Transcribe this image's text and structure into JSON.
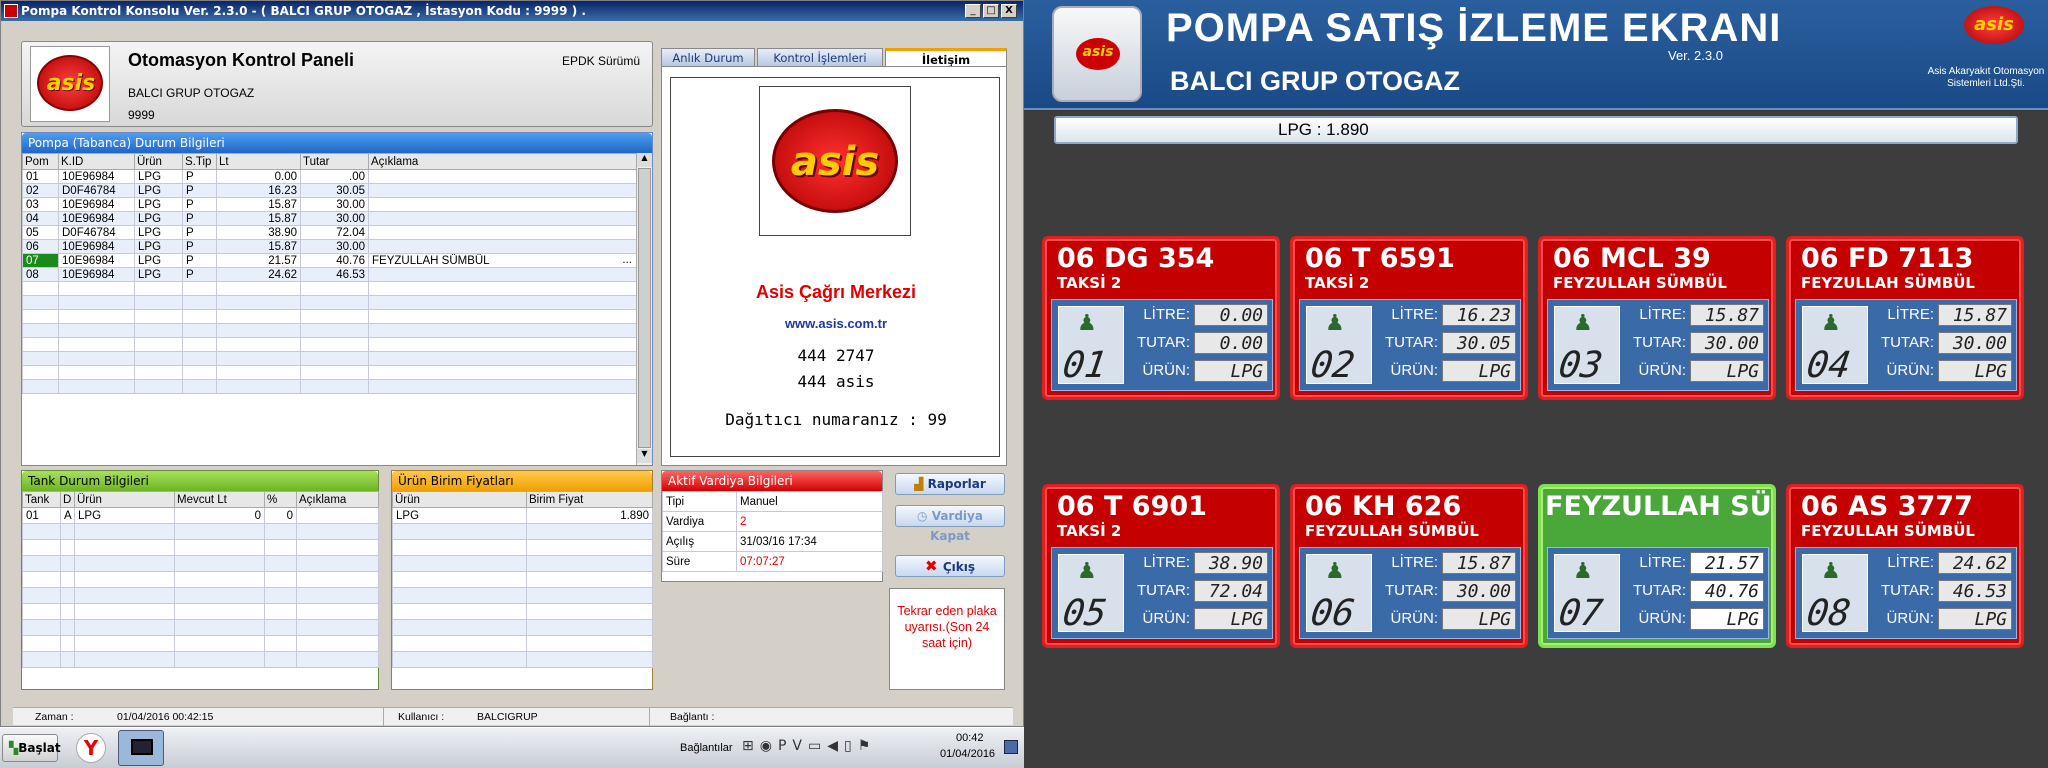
{
  "window": {
    "title": "Pompa Kontrol Konsolu Ver. 2.3.0  - ( BALCI GRUP OTOGAZ ,  İstasyon Kodu : 9999 ) .",
    "controls": [
      "_",
      "□",
      "X"
    ]
  },
  "header": {
    "logo_text": "asis",
    "title": "Otomasyon Kontrol Paneli",
    "company": "BALCI GRUP OTOGAZ",
    "station_code": "9999",
    "edition": "EPDK Sürümü"
  },
  "tabs": [
    {
      "label": "Anlık Durum",
      "active": false
    },
    {
      "label": "Kontrol İşlemleri",
      "active": false
    },
    {
      "label": "İletişim",
      "active": true
    }
  ],
  "pump_panel": {
    "title": "Pompa (Tabanca) Durum Bilgileri",
    "columns": [
      "Pom",
      "K.ID",
      "Ürün",
      "S.Tip",
      "Lt",
      "Tutar",
      "Açıklama"
    ],
    "rows": [
      [
        "01",
        "10E96984",
        "LPG",
        "P",
        "0.00",
        ".00",
        ""
      ],
      [
        "02",
        "D0F46784",
        "LPG",
        "P",
        "16.23",
        "30.05",
        ""
      ],
      [
        "03",
        "10E96984",
        "LPG",
        "P",
        "15.87",
        "30.00",
        ""
      ],
      [
        "04",
        "10E96984",
        "LPG",
        "P",
        "15.87",
        "30.00",
        ""
      ],
      [
        "05",
        "D0F46784",
        "LPG",
        "P",
        "38.90",
        "72.04",
        ""
      ],
      [
        "06",
        "10E96984",
        "LPG",
        "P",
        "15.87",
        "30.00",
        ""
      ],
      [
        "07",
        "10E96984",
        "LPG",
        "P",
        "21.57",
        "40.76",
        "FEYZULLAH SÜMBÜL"
      ],
      [
        "08",
        "10E96984",
        "LPG",
        "P",
        "24.62",
        "46.53",
        ""
      ]
    ],
    "ellipsis": "..."
  },
  "contact": {
    "logo_text": "asis",
    "center_name": "Asis Çağrı Merkezi",
    "website": "www.asis.com.tr",
    "phone1": "444 2747",
    "phone2": "444 asis",
    "distributor": "Dağıtıcı numaranız : 99"
  },
  "tank_panel": {
    "title": "Tank Durum Bilgileri",
    "columns": [
      "Tank",
      "D",
      "Ürün",
      "Mevcut Lt",
      "%",
      "Açıklama"
    ],
    "rows": [
      [
        "01",
        "A",
        "LPG",
        "0",
        "0",
        ""
      ]
    ]
  },
  "price_panel": {
    "title": "Ürün Birim Fiyatları",
    "columns": [
      "Ürün",
      "Birim Fiyat"
    ],
    "rows": [
      [
        "LPG",
        "1.890"
      ]
    ]
  },
  "shift_panel": {
    "title": "Aktif Vardiya Bilgileri",
    "rows": [
      {
        "label": "Tipi",
        "value": "Manuel"
      },
      {
        "label": "Vardiya",
        "value": "2"
      },
      {
        "label": "Açılış",
        "value": "31/03/16 17:34"
      },
      {
        "label": "Süre",
        "value": "07:07:27"
      }
    ]
  },
  "buttons": {
    "reports": "Raporlar",
    "close_shift": "Vardiya Kapat",
    "exit": "Çıkış"
  },
  "warning": "Tekrar eden plaka uyarısı.(Son 24 saat için)",
  "statusbar": {
    "time_label": "Zaman :",
    "time_value": "01/04/2016 00:42:15",
    "user_label": "Kullanıcı :",
    "user_value": "BALCIGRUP",
    "conn_label": "Bağlantı :"
  },
  "taskbar": {
    "start": "Başlat",
    "connections": "Bağlantılar",
    "clock_time": "00:42",
    "clock_date": "01/04/2016"
  },
  "monitor": {
    "title": "POMPA SATIŞ İZLEME EKRANI",
    "subtitle": "BALCI GRUP OTOGAZ",
    "version": "Ver. 2.3.0",
    "brand_logo": "asis",
    "brand_text": "Asis Akaryakıt Otomasyon Sistemleri Ltd.Şti.",
    "price_bar": "LPG : 1.890",
    "label_litre": "LİTRE:",
    "label_tutar": "TUTAR:",
    "label_urun": "ÜRÜN:",
    "pumps": [
      {
        "plate": "06 DG 354",
        "owner": "TAKSİ 2",
        "no": "01",
        "litre": "0.00",
        "tutar": "0.00",
        "urun": "LPG",
        "active": false
      },
      {
        "plate": "06 T 6591",
        "owner": "TAKSİ 2",
        "no": "02",
        "litre": "16.23",
        "tutar": "30.05",
        "urun": "LPG",
        "active": false
      },
      {
        "plate": "06 MCL 39",
        "owner": "FEYZULLAH SÜMBÜL",
        "no": "03",
        "litre": "15.87",
        "tutar": "30.00",
        "urun": "LPG",
        "active": false
      },
      {
        "plate": "06 FD 7113",
        "owner": "FEYZULLAH SÜMBÜL",
        "no": "04",
        "litre": "15.87",
        "tutar": "30.00",
        "urun": "LPG",
        "active": false
      },
      {
        "plate": "06 T 6901",
        "owner": "TAKSİ 2",
        "no": "05",
        "litre": "38.90",
        "tutar": "72.04",
        "urun": "LPG",
        "active": false
      },
      {
        "plate": "06 KH 626",
        "owner": "FEYZULLAH SÜMBÜL",
        "no": "06",
        "litre": "15.87",
        "tutar": "30.00",
        "urun": "LPG",
        "active": false
      },
      {
        "plate": "FEYZULLAH SÜ",
        "owner": "",
        "no": "07",
        "litre": "21.57",
        "tutar": "40.76",
        "urun": "LPG",
        "active": true
      },
      {
        "plate": "06 AS 3777",
        "owner": "FEYZULLAH SÜMBÜL",
        "no": "08",
        "litre": "24.62",
        "tutar": "46.53",
        "urun": "LPG",
        "active": false
      }
    ]
  },
  "colors": {
    "active_card": "#4aa83a",
    "idle_card": "#c40000",
    "accent_red": "#e00000",
    "link_blue": "#1a3aa0"
  }
}
